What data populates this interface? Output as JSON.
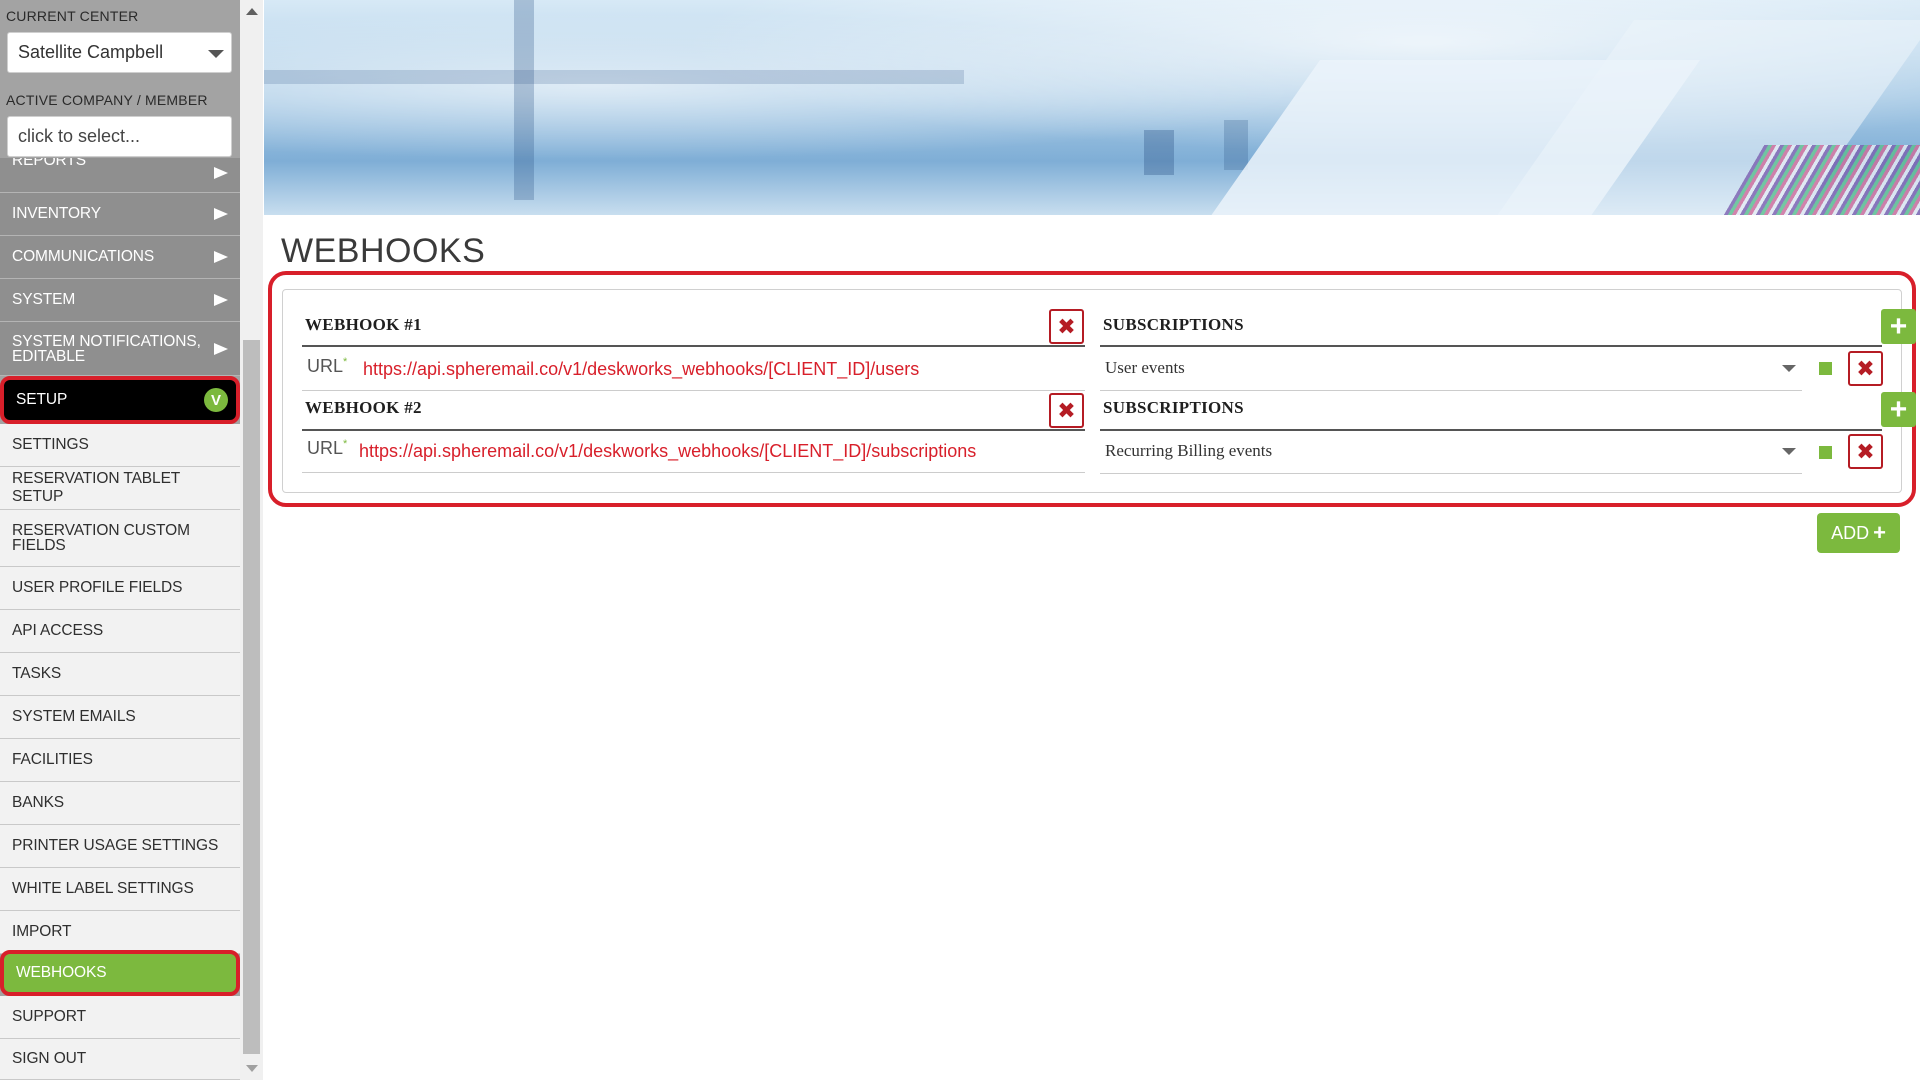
{
  "sidebar": {
    "current_center_label": "CURRENT CENTER",
    "current_center_value": "Satellite Campbell",
    "active_company_label": "ACTIVE COMPANY / MEMBER",
    "active_company_placeholder": "click to select...",
    "reports_label": "REPORTS",
    "inventory_label": "INVENTORY",
    "communications_label": "COMMUNICATIONS",
    "system_label": "SYSTEM",
    "system_notifications_label": "SYSTEM NOTIFICATIONS, EDITABLE",
    "setup_label": "SETUP",
    "setup_badge": "V",
    "items": [
      "SETTINGS",
      "RESERVATION TABLET SETUP",
      "RESERVATION CUSTOM FIELDS",
      "USER PROFILE FIELDS",
      "API ACCESS",
      "TASKS",
      "SYSTEM EMAILS",
      "FACILITIES",
      "BANKS",
      "PRINTER USAGE SETTINGS",
      "WHITE LABEL SETTINGS",
      "IMPORT",
      "WEBHOOKS",
      "SUPPORT",
      "SIGN OUT"
    ]
  },
  "main": {
    "page_title": "WEBHOOKS",
    "webhooks": [
      {
        "title": "WEBHOOK #1",
        "url_label": "URL",
        "url": "https://api.spheremail.co/v1/deskworks_webhooks/[CLIENT_ID]/users",
        "subscriptions_label": "SUBSCRIPTIONS",
        "subscription": "User events"
      },
      {
        "title": "WEBHOOK #2",
        "url_label": "URL",
        "url": "https://api.spheremail.co/v1/deskworks_webhooks/[CLIENT_ID]/subscriptions",
        "subscriptions_label": "SUBSCRIPTIONS",
        "subscription": "Recurring Billing events"
      }
    ],
    "add_label": "ADD",
    "add_icon": "+",
    "delete_icon": "✖",
    "plus_icon": "+"
  },
  "colors": {
    "accent_green": "#7cb93e",
    "highlight_red": "#d81f2a",
    "delete_red": "#b51c24"
  }
}
